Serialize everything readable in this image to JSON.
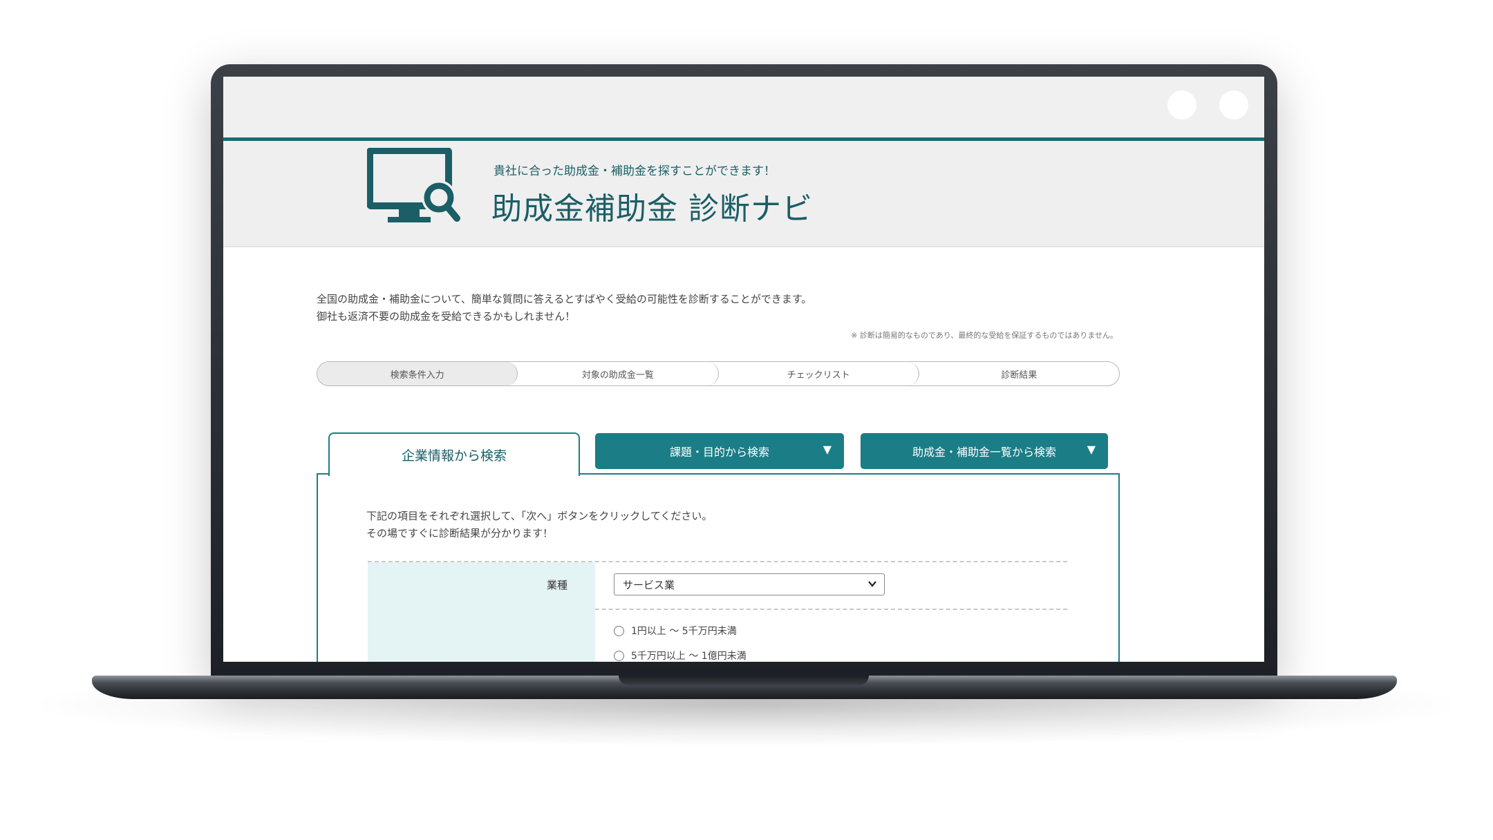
{
  "header": {
    "tagline": "貴社に合った助成金・補助金を探すことができます！",
    "title": "助成金補助金 診断ナビ"
  },
  "intro": {
    "line1": "全国の助成金・補助金について、簡単な質問に答えるとすばやく受給の可能性を診断することができます。",
    "line2": "御社も返済不要の助成金を受給できるかもしれません！",
    "disclaimer": "※ 診断は簡易的なものであり、最終的な受給を保証するものではありません。"
  },
  "steps": [
    "検索条件入力",
    "対象の助成金一覧",
    "チェックリスト",
    "診断結果"
  ],
  "tabs": {
    "active": "企業情報から検索",
    "by_purpose": "課題・目的から検索",
    "by_list": "助成金・補助金一覧から検索",
    "caret": "▼"
  },
  "form": {
    "instructions_line1": "下記の項目をそれぞれ選択して、「次へ」ボタンをクリックしてください。",
    "instructions_line2": "その場ですぐに診断結果が分かります！",
    "industry_label": "業種",
    "industry_value": "サービス業",
    "capital_option1": "1円以上 ～ 5千万円未満",
    "capital_option2": "5千万円以上 ～ 1億円未満"
  },
  "colors": {
    "accent": "#1b7d85",
    "header_bg": "#efefef",
    "label_bg": "#e4f3f4"
  }
}
